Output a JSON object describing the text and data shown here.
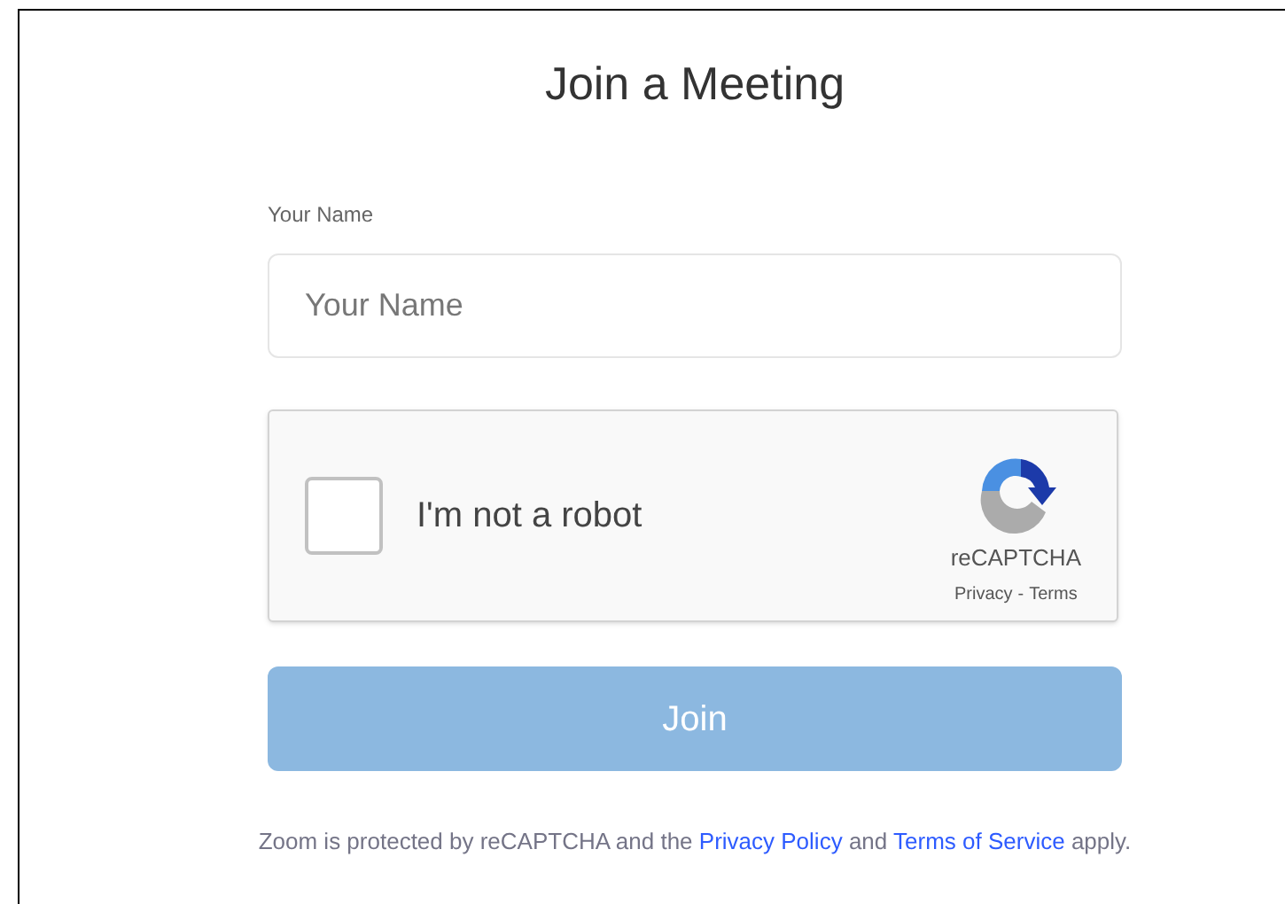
{
  "title": "Join a Meeting",
  "name_field": {
    "label": "Your Name",
    "placeholder": "Your Name"
  },
  "captcha": {
    "checked": false,
    "label": "I'm not a robot",
    "brand": "reCAPTCHA",
    "privacy": "Privacy",
    "separator": "-",
    "terms": "Terms"
  },
  "join_button": {
    "label": "Join",
    "disabled": true
  },
  "footer": [
    {
      "kind": "text",
      "text": "Zoom is protected by reCAPTCHA and the "
    },
    {
      "kind": "link",
      "text": "Privacy Policy"
    },
    {
      "kind": "text",
      "text": " and "
    },
    {
      "kind": "link",
      "text": "Terms of Service"
    },
    {
      "kind": "text",
      "text": " apply."
    }
  ]
}
